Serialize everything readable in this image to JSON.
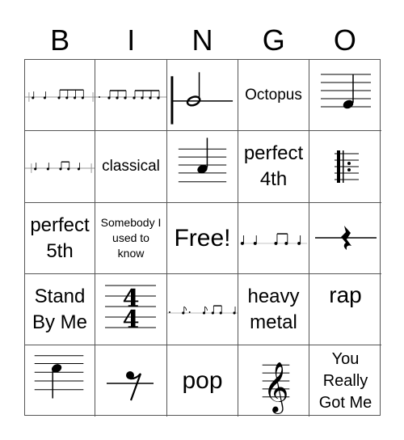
{
  "header": {
    "letters": [
      "B",
      "I",
      "N",
      "G",
      "O"
    ]
  },
  "cells": [
    {
      "icon": "rhythm-quarters-eighths"
    },
    {
      "icon": "rhythm-eighth-groups"
    },
    {
      "icon": "half-note"
    },
    {
      "text": "Octopus"
    },
    {
      "icon": "staff-note-e"
    },
    {
      "icon": "rhythm-quarters-eighth-pair"
    },
    {
      "text": "classical"
    },
    {
      "icon": "staff-note-g"
    },
    {
      "text": "perfect 4th"
    },
    {
      "icon": "repeat-sign"
    },
    {
      "text": "perfect 5th"
    },
    {
      "text": "Somebody I used to know"
    },
    {
      "text": "Free!"
    },
    {
      "icon": "rhythm-quarters-eighth-pair"
    },
    {
      "icon": "quarter-rest"
    },
    {
      "text": "Stand By Me"
    },
    {
      "icon": "time-signature-4-4"
    },
    {
      "icon": "rhythm-eighth-rests"
    },
    {
      "text": "heavy metal"
    },
    {
      "text": "rap"
    },
    {
      "icon": "staff-note-c"
    },
    {
      "icon": "eighth-rest"
    },
    {
      "text": "pop"
    },
    {
      "icon": "treble-clef"
    },
    {
      "text": "You Really Got Me"
    }
  ]
}
